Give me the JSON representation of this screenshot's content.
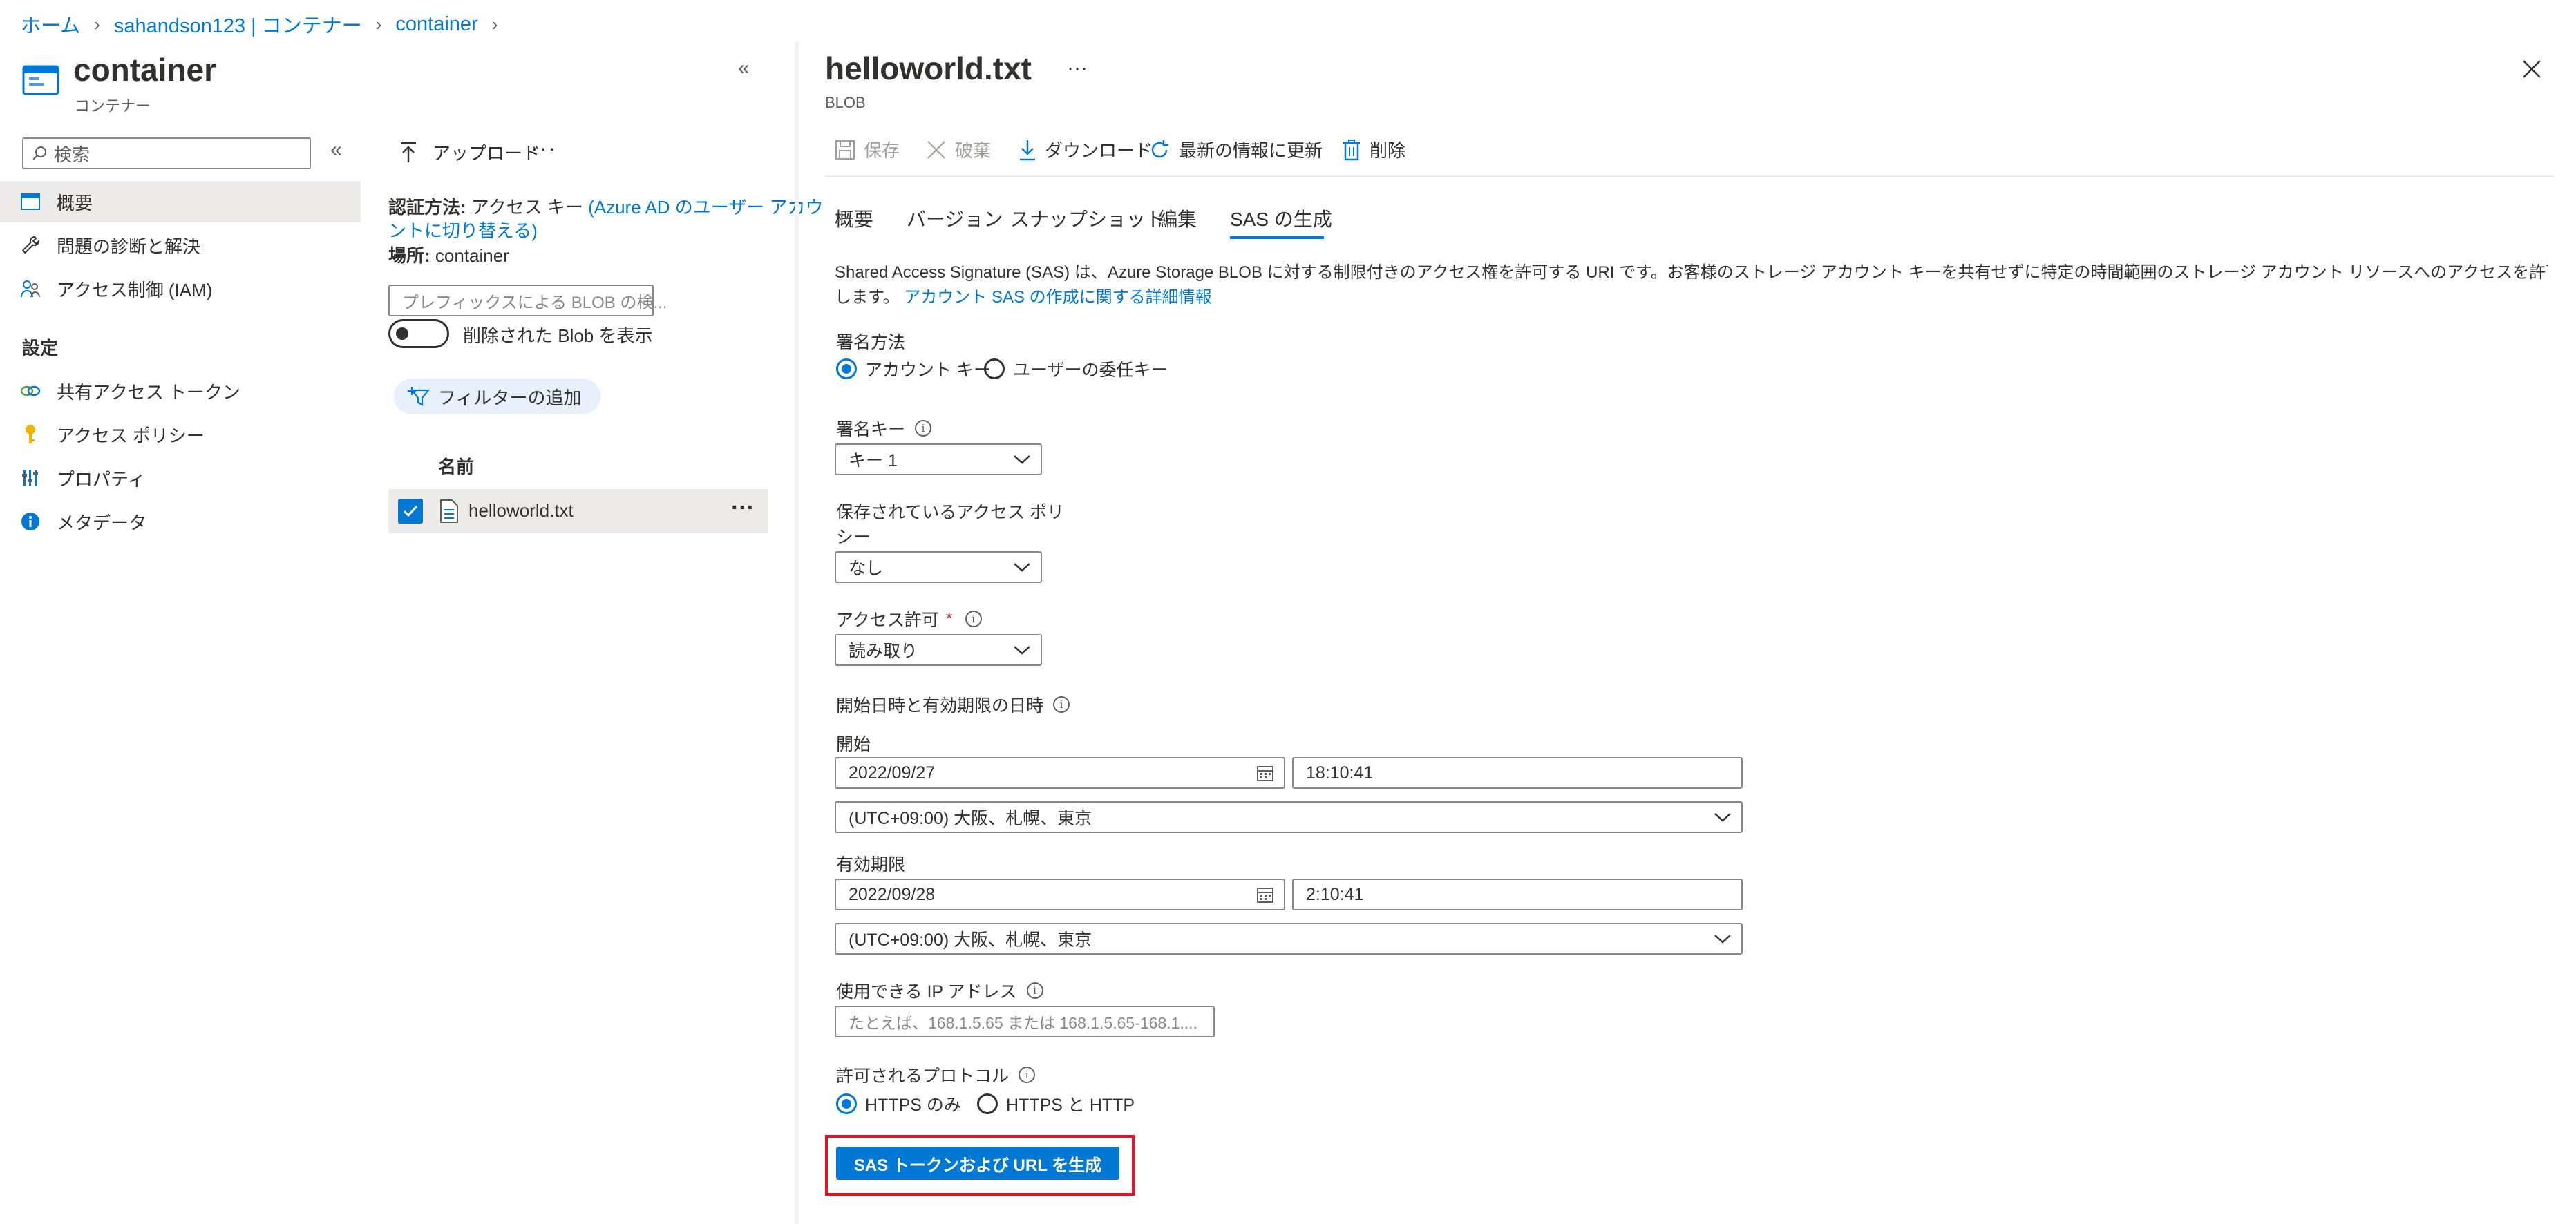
{
  "breadcrumb": [
    "ホーム",
    "sahandson123 | コンテナー",
    "container"
  ],
  "left": {
    "title": "container",
    "subtitle": "コンテナー",
    "search_placeholder": "検索",
    "nav": [
      {
        "label": "概要",
        "icon": "overview-icon",
        "selected": true
      },
      {
        "label": "問題の診断と解決",
        "icon": "wrench-icon"
      },
      {
        "label": "アクセス制御 (IAM)",
        "icon": "people-icon"
      }
    ],
    "settings_header": "設定",
    "settings": [
      {
        "label": "共有アクセス トークン",
        "icon": "link-icon"
      },
      {
        "label": "アクセス ポリシー",
        "icon": "key-icon"
      },
      {
        "label": "プロパティ",
        "icon": "properties-icon"
      },
      {
        "label": "メタデータ",
        "icon": "info-icon"
      }
    ]
  },
  "middle": {
    "upload": "アップロード",
    "auth_label": "認証方法:",
    "auth_value": "アクセス キー",
    "auth_link_1": "(Azure AD のユーザー アカウ",
    "auth_link_2": "ントに切り替える)",
    "location_label": "場所:",
    "location_value": "container",
    "prefix_placeholder": "プレフィックスによる BLOB の検...",
    "show_deleted": "削除された Blob を表示",
    "add_filter": "フィルターの追加",
    "col_name": "名前",
    "file": "helloworld.txt"
  },
  "right": {
    "title": "helloworld.txt",
    "subtitle": "BLOB",
    "toolbar": {
      "save": "保存",
      "discard": "破棄",
      "download": "ダウンロード",
      "refresh": "最新の情報に更新",
      "delete": "削除"
    },
    "tabs": [
      "概要",
      "バージョン",
      "スナップショット",
      "編集",
      "SAS の生成"
    ],
    "desc_1": "Shared Access Signature (SAS) は、Azure Storage BLOB に対する制限付きのアクセス権を許可する URI です。お客様のストレージ アカウント キーを共有せずに特定の時間範囲のストレージ アカウント リソースへのアクセスを許可する場合に使用",
    "desc_2": "します。",
    "desc_link": "アカウント SAS の作成に関する詳細情報",
    "sign_method_label": "署名方法",
    "sign_method_opt1": "アカウント キー",
    "sign_method_opt2": "ユーザーの委任キー",
    "sign_key_label": "署名キー",
    "sign_key_value": "キー 1",
    "stored_policy_label_1": "保存されているアクセス ポリ",
    "stored_policy_label_2": "シー",
    "stored_policy_value": "なし",
    "permissions_label": "アクセス許可",
    "permissions_required": "*",
    "permissions_value": "読み取り",
    "dates_label": "開始日時と有効期限の日時",
    "start_label": "開始",
    "start_date": "2022/09/27",
    "start_time": "18:10:41",
    "start_tz": "(UTC+09:00) 大阪、札幌、東京",
    "expiry_label": "有効期限",
    "expiry_date": "2022/09/28",
    "expiry_time": "2:10:41",
    "expiry_tz": "(UTC+09:00) 大阪、札幌、東京",
    "ip_label": "使用できる IP アドレス",
    "ip_placeholder": "たとえば、168.1.5.65 または 168.1.5.65-168.1....",
    "protocol_label": "許可されるプロトコル",
    "protocol_opt1": "HTTPS のみ",
    "protocol_opt2": "HTTPS と HTTP",
    "generate_button": "SAS トークンおよび URL を生成"
  }
}
